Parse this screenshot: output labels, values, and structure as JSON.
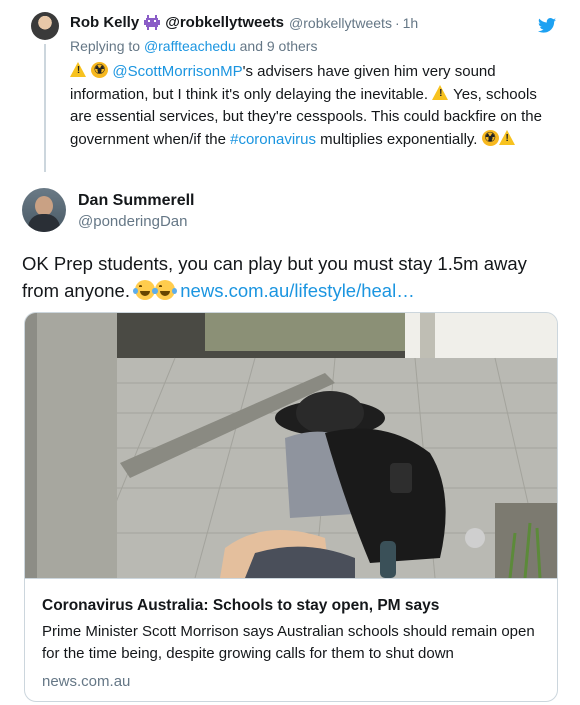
{
  "parent_tweet": {
    "author_name": "Rob Kelly",
    "author_handle_bold": "@robkellytweets",
    "author_handle": "@robkellytweets",
    "time": "1h",
    "replying_prefix": "Replying to",
    "replying_user": "@raffteachedu",
    "replying_suffix": "and 9 others",
    "mention": "@ScottMorrisonMP",
    "text_part1": "'s advisers have given him very sound information, but I think it's only delaying the inevitable.",
    "text_part2": "Yes, schools are essential services, but they're cesspools. This could backfire on the government when/if the",
    "hashtag": "#coronavirus",
    "text_part3": "multiplies exponentially."
  },
  "main_tweet": {
    "author_name": "Dan Summerell",
    "author_handle": "@ponderingDan",
    "text": "OK Prep students, you can play but you must stay 1.5m away from anyone.",
    "link": "news.com.au/lifestyle/heal…"
  },
  "link_card": {
    "title": "Coronavirus Australia: Schools to stay open, PM says",
    "description": "Prime Minister Scott Morrison says Australian schools should remain open for the time being, despite growing calls for them to shut down",
    "domain": "news.com.au"
  },
  "colors": {
    "link": "#1b95e0",
    "muted": "#657786",
    "text": "#14171a",
    "border": "#ccd6dd"
  },
  "icons": [
    "twitter-bird-icon",
    "alien-monster-icon",
    "warning-icon",
    "radioactive-icon",
    "laughing-crying-icon"
  ]
}
